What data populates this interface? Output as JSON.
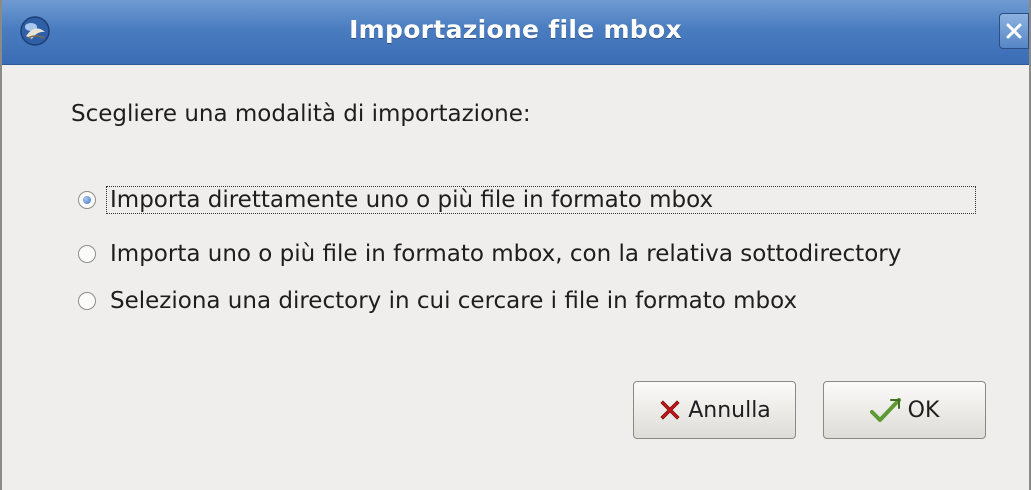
{
  "window": {
    "title": "Importazione file mbox",
    "close_label": "×"
  },
  "prompt": "Scegliere una modalità di importazione:",
  "options": [
    {
      "label": "Importa direttamente uno o più file in formato mbox",
      "selected": true
    },
    {
      "label": "Importa uno o più file in formato mbox, con la relativa sottodirectory",
      "selected": false
    },
    {
      "label": "Seleziona una directory in cui cercare i file in formato mbox",
      "selected": false
    }
  ],
  "buttons": {
    "cancel_label": "Annulla",
    "ok_label": "OK"
  },
  "icons": {
    "app": "thunderbird-icon",
    "close": "close-icon",
    "cancel": "red-x-icon",
    "ok": "green-check-icon"
  },
  "colors": {
    "titlebar": "#4a7cc0",
    "background": "#efeeec",
    "radio_selected": "#3f78c6",
    "cancel_icon": "#c41616",
    "ok_icon": "#5e9a34"
  }
}
